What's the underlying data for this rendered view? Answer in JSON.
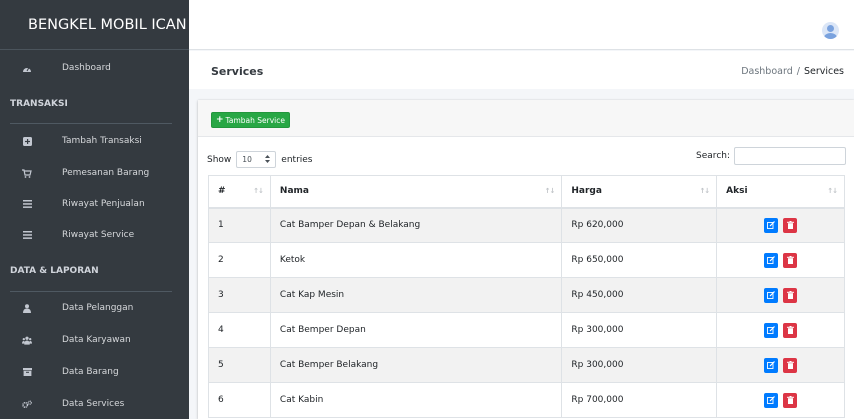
{
  "brand": "BENGKEL MOBIL ICAN",
  "sidebar": {
    "dashboard": "Dashboard",
    "sections": [
      {
        "header": "TRANSAKSI"
      },
      {
        "header": "DATA & LAPORAN"
      }
    ],
    "items": [
      {
        "label": "Tambah Transaksi",
        "icon": "plus-square-icon"
      },
      {
        "label": "Pemesanan Barang",
        "icon": "cart-icon"
      },
      {
        "label": "Riwayat Penjualan",
        "icon": "list-icon"
      },
      {
        "label": "Riwayat Service",
        "icon": "list-icon"
      },
      {
        "label": "Data Pelanggan",
        "icon": "user-icon"
      },
      {
        "label": "Data Karyawan",
        "icon": "users-icon"
      },
      {
        "label": "Data Barang",
        "icon": "box-icon"
      },
      {
        "label": "Data Services",
        "icon": "cogs-icon"
      }
    ]
  },
  "header": {
    "title": "Services",
    "breadcrumb_home": "Dashboard",
    "breadcrumb_sep": "/",
    "breadcrumb_active": "Services"
  },
  "card": {
    "add_button": "Tambah Service",
    "add_icon": "+",
    "show_label": "Show",
    "entries_value": "10",
    "entries_label": "entries",
    "search_label": "Search:"
  },
  "table": {
    "headers": [
      "#",
      "Nama",
      "Harga",
      "Aksi"
    ],
    "sort_glyph": "↑↓",
    "rows": [
      {
        "no": "1",
        "nama": "Cat Bamper Depan & Belakang",
        "harga": "Rp 620,000"
      },
      {
        "no": "2",
        "nama": "Ketok",
        "harga": "Rp 650,000"
      },
      {
        "no": "3",
        "nama": "Cat Kap Mesin",
        "harga": "Rp 450,000"
      },
      {
        "no": "4",
        "nama": "Cat Bemper Depan",
        "harga": "Rp 300,000"
      },
      {
        "no": "5",
        "nama": "Cat Bemper Belakang",
        "harga": "Rp 300,000"
      },
      {
        "no": "6",
        "nama": "Cat Kabin",
        "harga": "Rp 700,000"
      }
    ]
  },
  "colors": {
    "sidebar_bg": "#343a40",
    "success": "#28a745",
    "primary": "#007bff",
    "danger": "#dc3545"
  }
}
